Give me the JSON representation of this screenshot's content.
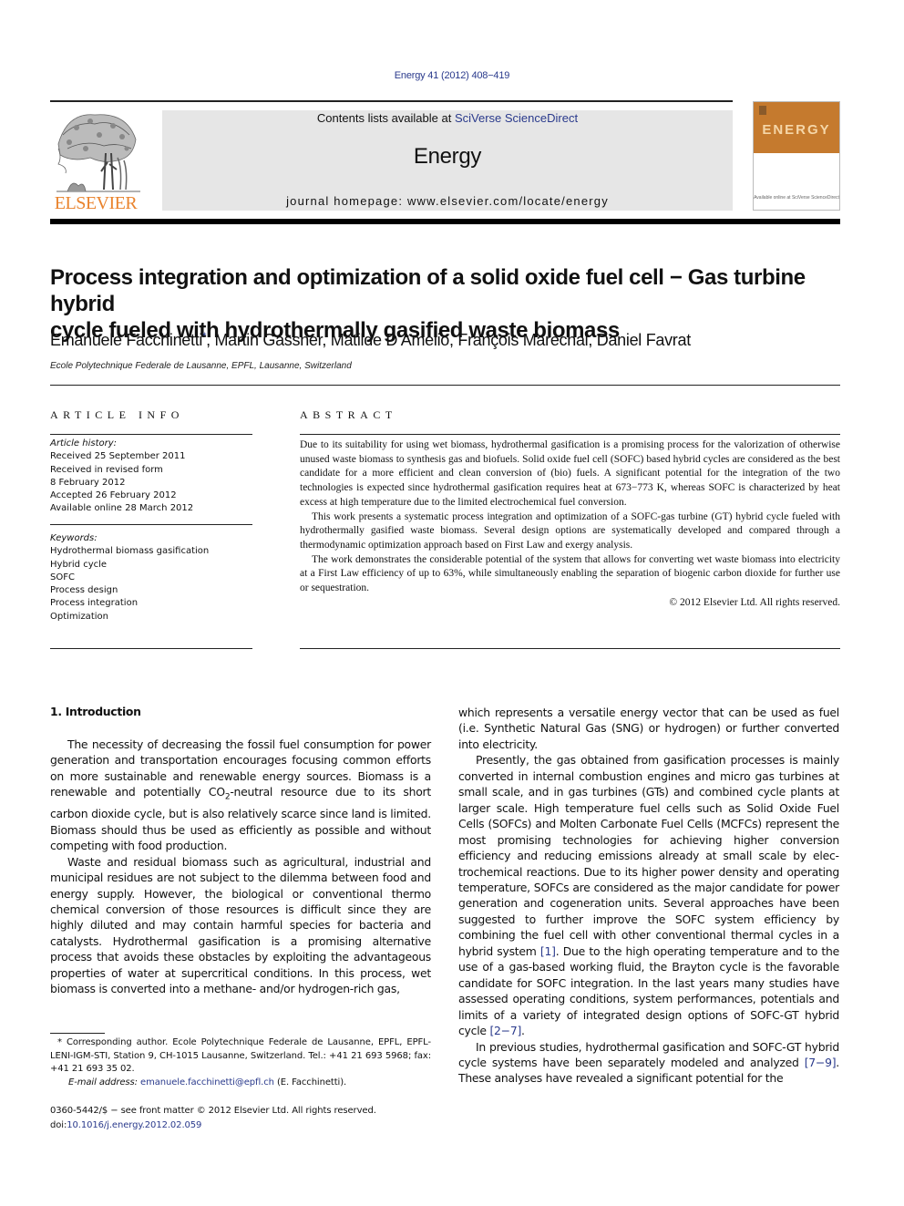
{
  "citation": "Energy 41 (2012) 408−419",
  "header": {
    "publisher": "ELSEVIER",
    "contents_prefix": "Contents lists available at ",
    "contents_link": "SciVerse ScienceDirect",
    "journal_name": "Energy",
    "homepage": "journal homepage: www.elsevier.com/locate/energy",
    "cover_title": "ENERGY",
    "cover_footer": "Available online at SciVerse ScienceDirect",
    "colors": {
      "publisher_orange": "#e9832d",
      "cover_orange": "#c57a2e",
      "link_blue": "#2a3a8c",
      "banner_gray": "#e6e6e6"
    }
  },
  "article": {
    "title_line1": "Process integration and optimization of a solid oxide fuel cell − Gas turbine hybrid",
    "title_line2": "cycle fueled with hydrothermally gasified waste biomass",
    "authors": [
      {
        "name": "Emanuele Facchinetti",
        "mark": "*",
        "sep": ", "
      },
      {
        "name": "Martin Gassner",
        "mark": "",
        "sep": ", "
      },
      {
        "name": "Matilde D’Amelio",
        "mark": "",
        "sep": ", "
      },
      {
        "name": "François Marechal",
        "mark": "",
        "sep": ", "
      },
      {
        "name": "Daniel Favrat",
        "mark": "",
        "sep": ""
      }
    ],
    "affiliation": "Ecole Polytechnique Federale de Lausanne, EPFL, Lausanne, Switzerland"
  },
  "article_info": {
    "label": "ARTICLE INFO",
    "history_head": "Article history:",
    "history": [
      "Received 25 September 2011",
      "Received in revised form",
      "8 February 2012",
      "Accepted 26 February 2012",
      "Available online 28 March 2012"
    ],
    "keywords_head": "Keywords:",
    "keywords": [
      "Hydrothermal biomass gasification",
      "Hybrid cycle",
      "SOFC",
      "Process design",
      "Process integration",
      "Optimization"
    ]
  },
  "abstract": {
    "label": "ABSTRACT",
    "paragraphs": [
      "Due to its suitability for using wet biomass, hydrothermal gasification is a promising process for the valorization of otherwise unused waste biomass to synthesis gas and biofuels. Solid oxide fuel cell (SOFC) based hybrid cycles are considered as the best candidate for a more efficient and clean conversion of (bio) fuels. A significant potential for the integration of the two technologies is expected since hydrothermal gasification requires heat at 673−773 K, whereas SOFC is characterized by heat excess at high temper­ature due to the limited electrochemical fuel conversion.",
      "This work presents a systematic process integration and optimization of a SOFC-gas turbine (GT) hybrid cycle fueled with hydrothermally gasified waste biomass. Several design options are systemati­cally developed and compared through a thermodynamic optimization approach based on First Law and exergy analysis.",
      "The work demonstrates the considerable potential of the system that allows for converting wet waste biomass into electricity at a First Law efficiency of up to 63%, while simultaneously enabling the sepa­ration of biogenic carbon dioxide for further use or sequestration."
    ],
    "copyright": "© 2012 Elsevier Ltd. All rights reserved."
  },
  "introduction": {
    "heading": "1.  Introduction",
    "left_paragraphs": [
      {
        "before": "The necessity of decreasing the fossil fuel consumption for power generation and transportation encourages focusing common efforts on more sustainable and renewable energy sources. Biomass is a renewable and potentially CO",
        "sub": "2",
        "after": "-neutral resource due to its short carbon dioxide cycle, but is also relatively scarce since land is limited. Biomass should thus be used as efficiently as possible and without competing with food production."
      },
      {
        "before": "Waste and residual biomass such as agricultural, industrial and municipal residues are not subject to the dilemma between food and energy supply. However, the biological or conventional thermo chemical conversion of those resources is difficult since they are highly diluted and may contain harmful species for bacteria and catalysts. Hydrothermal gasification is a promising alternative process that avoids these obstacles by exploiting the advantageous properties of water at supercritical conditions. In this process, wet biomass is converted into a methane- and/or hydrogen-rich gas,",
        "sub": "",
        "after": ""
      }
    ],
    "right_p1": "which represents a versatile energy vector that can be used as fuel (i.e. Synthetic Natural Gas (SNG) or hydrogen) or further converted into electricity.",
    "right_p2_a": "Presently, the gas obtained from gasification processes is mainly converted in internal combustion engines and micro gas turbines at small scale, and in gas turbines (GTs) and combined cycle plants at larger scale. High temperature fuel cells such as Solid Oxide Fuel Cells (SOFCs) and Molten Carbonate Fuel Cells (MCFCs) represent the most promising technologies for achieving higher conversion efficiency and reducing emissions already at small scale by elec­trochemical reactions. Due to its higher power density and oper­ating temperature, SOFCs are considered as the major candidate for power generation and cogeneration units. Several approaches have been suggested to further improve the SOFC system efficiency by combining the fuel cell with other conventional thermal cycles in a hybrid system ",
    "right_p2_ref1": "[1]",
    "right_p2_b": ". Due to the high operating temperature and to the use of a gas-based working fluid, the Brayton cycle is the favorable candidate for SOFC integration. In the last years many studies have assessed operating conditions, system performances, potentials and limits of a variety of integrated design options of SOFC-GT hybrid cycle ",
    "right_p2_ref2": "[2−7]",
    "right_p2_c": ".",
    "right_p3_a": "In previous studies, hydrothermal gasification and SOFC-GT hybrid cycle systems have been separately modeled and analyzed ",
    "right_p3_ref": "[7−9]",
    "right_p3_b": ". These analyses have revealed a significant potential for the"
  },
  "footnote": {
    "corresponding": "* Corresponding author. Ecole Polytechnique Federale de Lausanne, EPFL, EPFL-LENI-IGM-STI, Station 9, CH-1015 Lausanne, Switzerland. Tel.: +41 21 693 5968; fax: +41 21 693 35 02.",
    "email_label": "E-mail address:",
    "email": "emanuele.facchinetti@epfl.ch",
    "email_suffix": " (E. Facchinetti).",
    "front_matter": "0360-5442/$ − see front matter © 2012 Elsevier Ltd. All rights reserved.",
    "doi_prefix": "doi:",
    "doi": "10.1016/j.energy.2012.02.059"
  }
}
